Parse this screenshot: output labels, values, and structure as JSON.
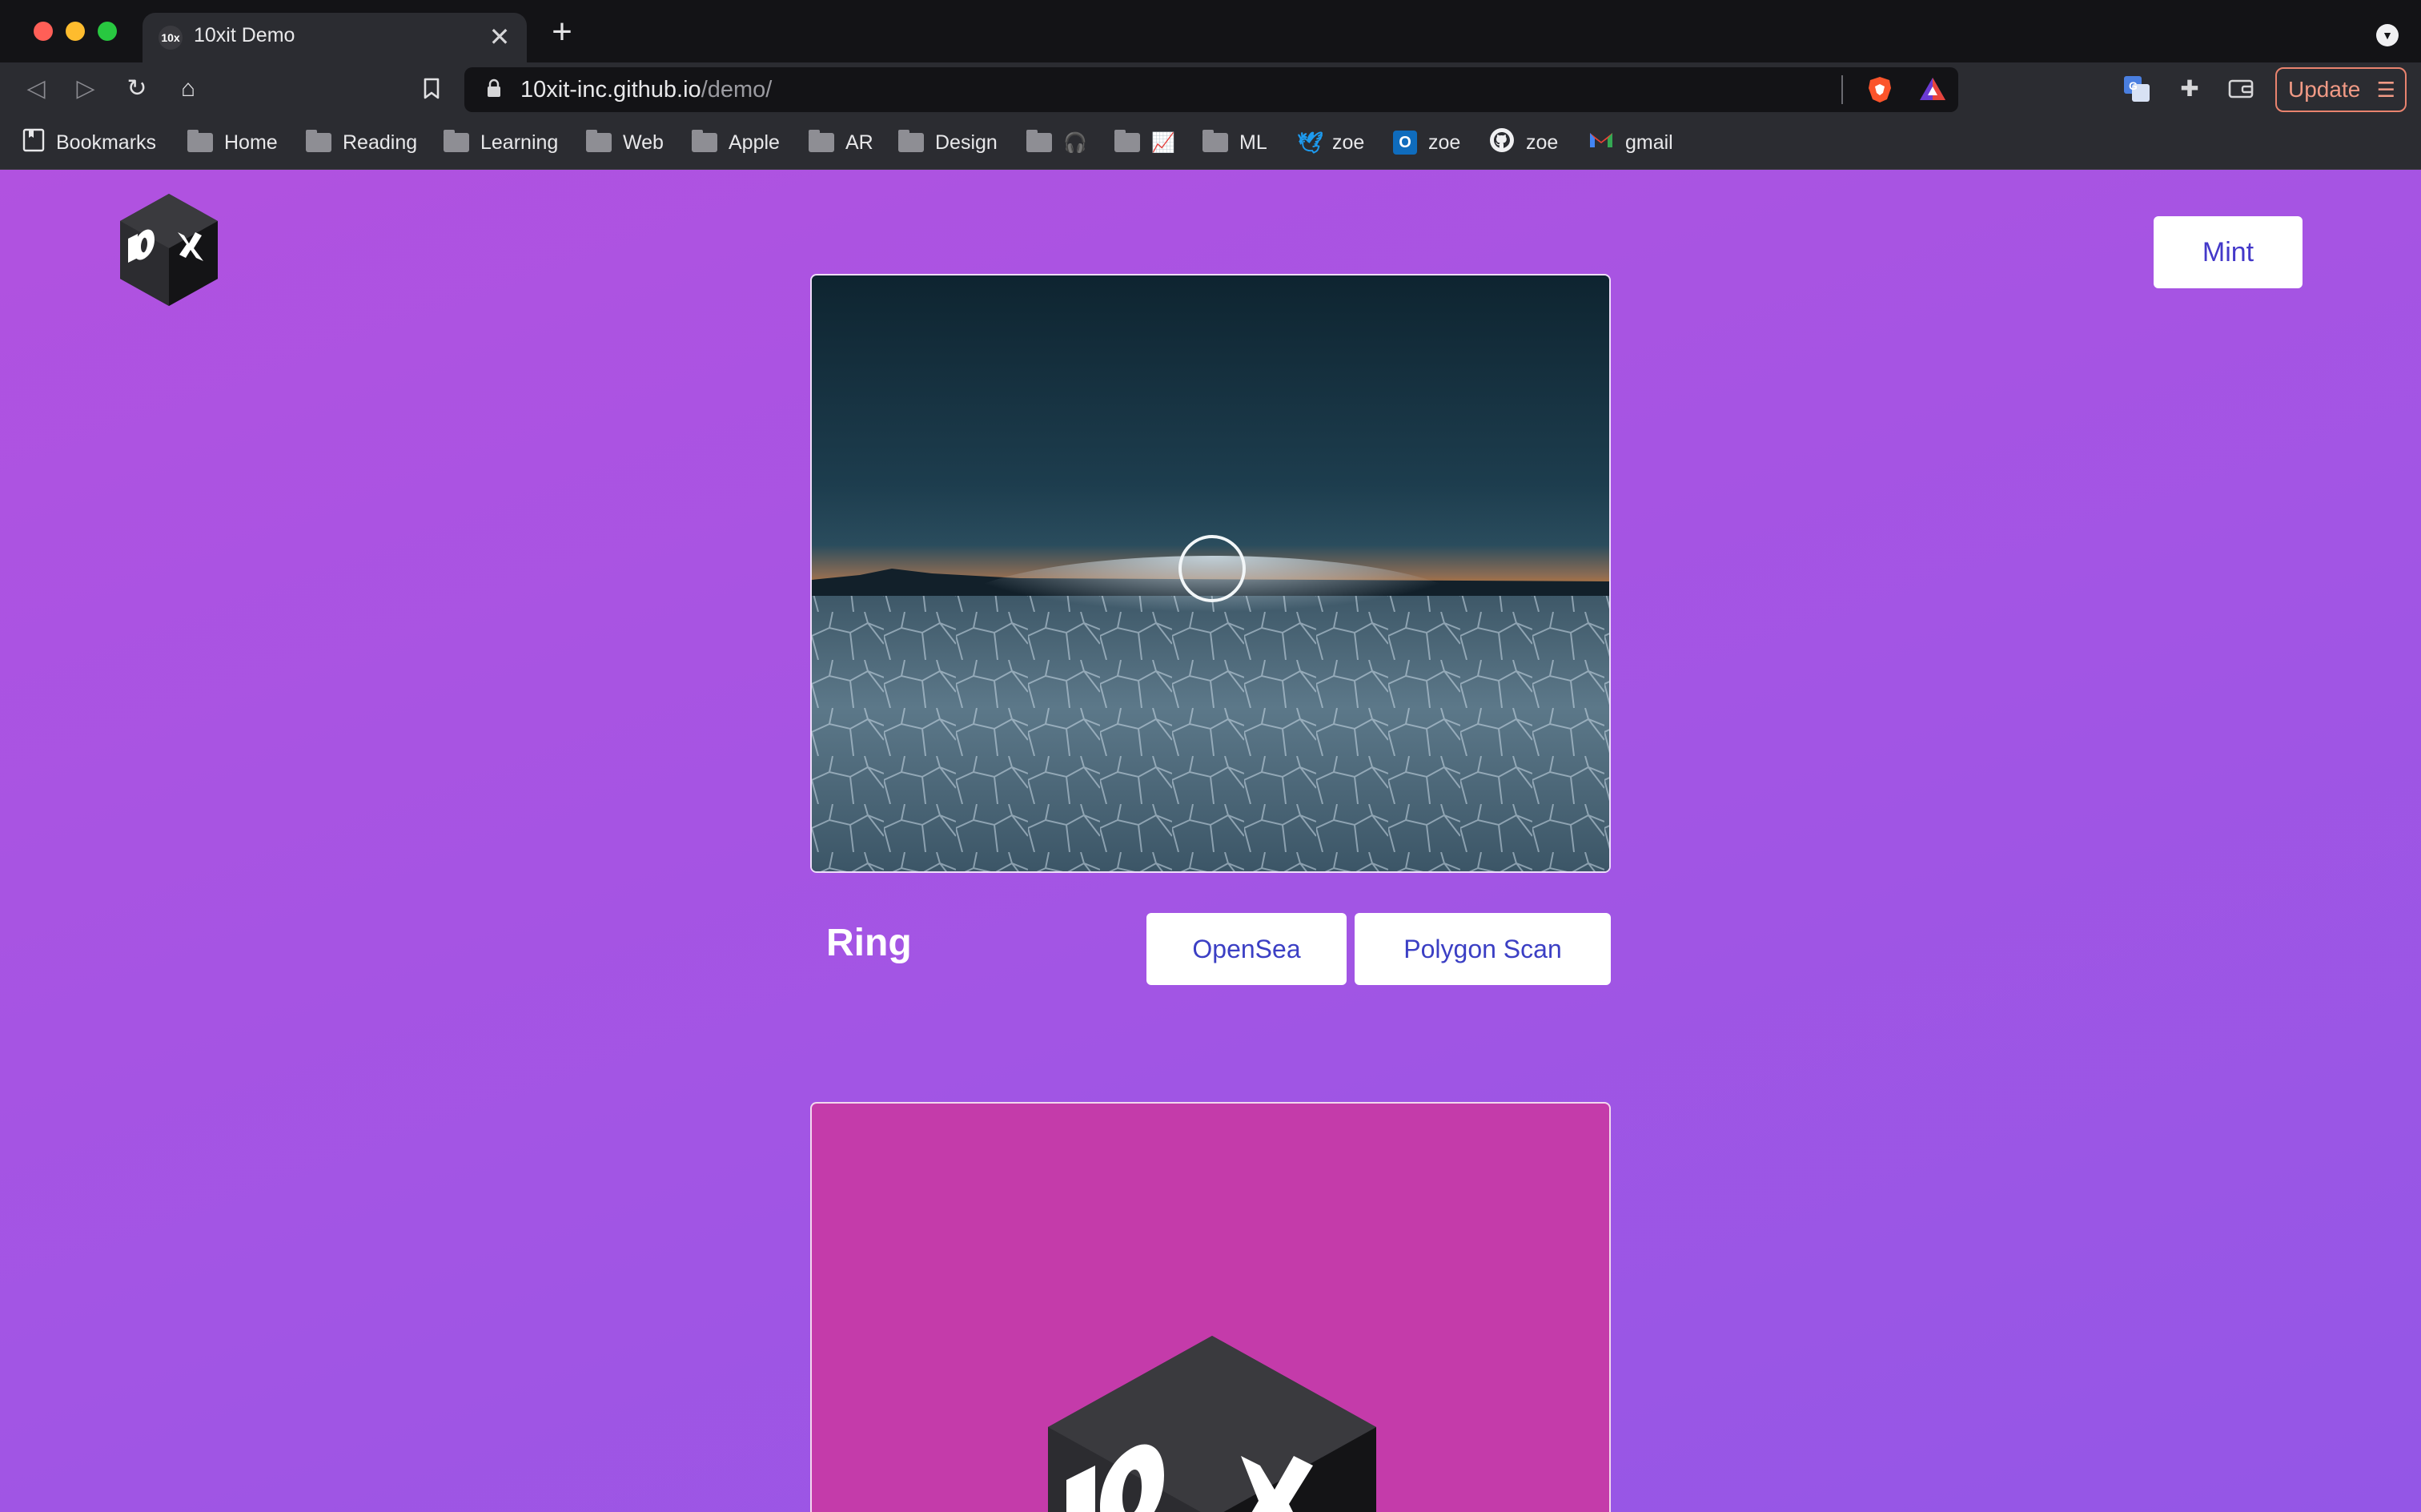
{
  "browser": {
    "tab": {
      "title": "10xit Demo",
      "favicon": "10x",
      "close": "✕"
    },
    "new_tab": "+",
    "url": {
      "host": "10xit-inc.github.io",
      "path": "/demo/"
    },
    "update_label": "Update",
    "bookmarks": [
      {
        "label": "Bookmarks",
        "icon": "bookmarks-icon"
      },
      {
        "label": "Home",
        "icon": "folder-icon"
      },
      {
        "label": "Reading",
        "icon": "folder-icon"
      },
      {
        "label": "Learning",
        "icon": "folder-icon"
      },
      {
        "label": "Web",
        "icon": "folder-icon"
      },
      {
        "label": "Apple",
        "icon": "folder-icon"
      },
      {
        "label": "AR",
        "icon": "folder-icon"
      },
      {
        "label": "Design",
        "icon": "folder-icon"
      },
      {
        "label": "🎧",
        "icon": "folder-icon"
      },
      {
        "label": "📈",
        "icon": "folder-icon"
      },
      {
        "label": "ML",
        "icon": "folder-icon"
      },
      {
        "label": "zoe",
        "icon": "twitter-icon"
      },
      {
        "label": "zoe",
        "icon": "outlook-icon"
      },
      {
        "label": "zoe",
        "icon": "github-icon"
      },
      {
        "label": "gmail",
        "icon": "gmail-icon"
      }
    ]
  },
  "page": {
    "mint_label": "Mint",
    "nft": {
      "name": "Ring",
      "opensea_label": "OpenSea",
      "polygon_label": "Polygon Scan"
    }
  },
  "colors": {
    "page_gradient_start": "#b152e0",
    "page_gradient_end": "#9456e6",
    "button_text": "#4338c9",
    "second_card_bg": "#c43baa"
  }
}
